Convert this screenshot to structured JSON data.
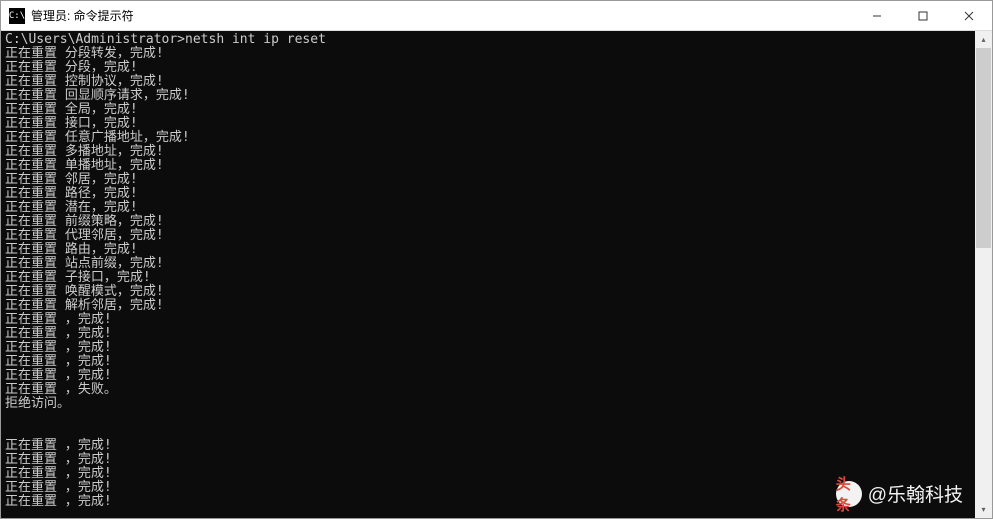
{
  "titlebar": {
    "icon_text": "C:\\",
    "title": "管理员: 命令提示符"
  },
  "terminal": {
    "prompt": "C:\\Users\\Administrator>",
    "command": "netsh int ip reset",
    "lines": [
      "正在重置 分段转发，完成!",
      "正在重置 分段，完成!",
      "正在重置 控制协议，完成!",
      "正在重置 回显顺序请求，完成!",
      "正在重置 全局，完成!",
      "正在重置 接口，完成!",
      "正在重置 任意广播地址，完成!",
      "正在重置 多播地址，完成!",
      "正在重置 单播地址，完成!",
      "正在重置 邻居，完成!",
      "正在重置 路径，完成!",
      "正在重置 潜在，完成!",
      "正在重置 前缀策略，完成!",
      "正在重置 代理邻居，完成!",
      "正在重置 路由，完成!",
      "正在重置 站点前缀，完成!",
      "正在重置 子接口，完成!",
      "正在重置 唤醒模式，完成!",
      "正在重置 解析邻居，完成!",
      "正在重置 ，完成!",
      "正在重置 ，完成!",
      "正在重置 ，完成!",
      "正在重置 ，完成!",
      "正在重置 ，完成!",
      "正在重置 ，失败。",
      "拒绝访问。",
      "",
      "",
      "正在重置 ，完成!",
      "正在重置 ，完成!",
      "正在重置 ，完成!",
      "正在重置 ，完成!",
      "正在重置 ，完成!"
    ]
  },
  "watermark": {
    "label": "头条",
    "text": "@乐翰科技"
  }
}
